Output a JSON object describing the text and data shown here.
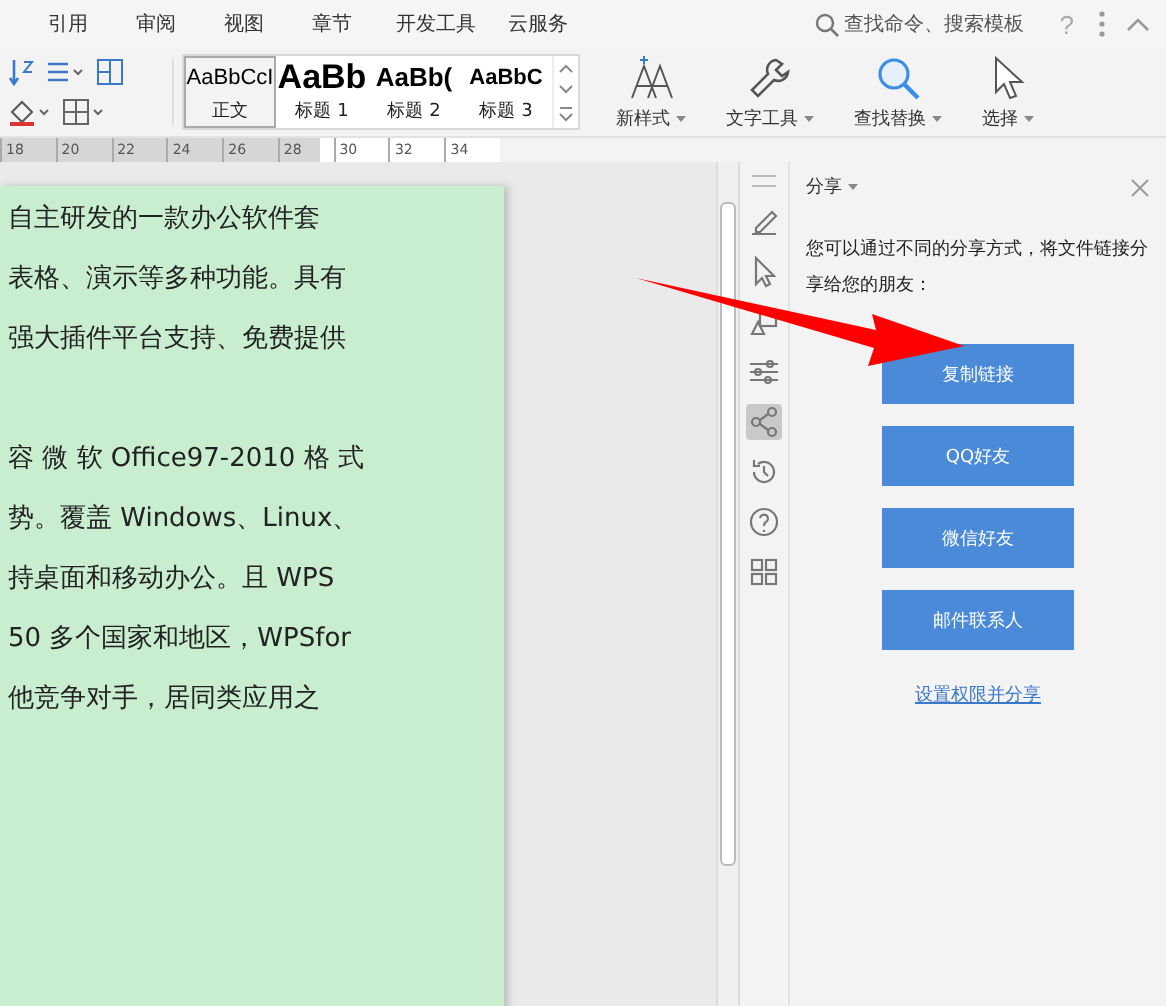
{
  "menu_tabs": [
    {
      "label": "引用",
      "selected": false
    },
    {
      "label": "审阅",
      "selected": false
    },
    {
      "label": "视图",
      "selected": false
    },
    {
      "label": "章节",
      "selected": false
    },
    {
      "label": "开发工具",
      "selected": false
    },
    {
      "label": "云服务",
      "selected": false
    }
  ],
  "search": {
    "placeholder": "查找命令、搜索模板"
  },
  "help": "?",
  "styles": [
    {
      "preview": "AaBbCcI",
      "label": "正文",
      "selected": true,
      "kind": "normal"
    },
    {
      "preview": "AaBb",
      "label": "标题 1",
      "selected": false,
      "kind": "h1"
    },
    {
      "preview": "AaBb(",
      "label": "标题 2",
      "selected": false,
      "kind": "h2"
    },
    {
      "preview": "AaBbC",
      "label": "标题 3",
      "selected": false,
      "kind": "h3"
    }
  ],
  "ribbon_buttons": [
    {
      "label": "新样式",
      "kind": "new-style"
    },
    {
      "label": "文字工具",
      "kind": "text-tools"
    },
    {
      "label": "查找替换",
      "kind": "find"
    },
    {
      "label": "选择",
      "kind": "select"
    }
  ],
  "ruler": [
    "18",
    "20",
    "22",
    "24",
    "26",
    "28",
    "30",
    "32",
    "34"
  ],
  "document_paragraphs": [
    [
      "自主研发的一款办公软件套",
      "表格、演示等多种功能。具有",
      "强大插件平台支持、免费提供"
    ],
    [
      "容 微 软 Office97-2010 格 式",
      "势。覆盖 Windows、Linux、",
      "持桌面和移动办公。且 WPS",
      "50 多个国家和地区，WPSfor",
      "他竞争对手，居同类应用之"
    ]
  ],
  "side_tools": [
    {
      "kind": "pen",
      "selected": false
    },
    {
      "kind": "cursor",
      "selected": false
    },
    {
      "kind": "shapes",
      "selected": false
    },
    {
      "kind": "sliders",
      "selected": false
    },
    {
      "kind": "share",
      "selected": true
    },
    {
      "kind": "history",
      "selected": false
    },
    {
      "kind": "help",
      "selected": false
    },
    {
      "kind": "grid",
      "selected": false
    }
  ],
  "panel": {
    "title": "分享",
    "description": "您可以通过不同的分享方式，将文件链接分享给您的朋友：",
    "buttons": [
      "复制链接",
      "QQ好友",
      "微信好友",
      "邮件联系人"
    ],
    "link": "设置权限并分享"
  }
}
